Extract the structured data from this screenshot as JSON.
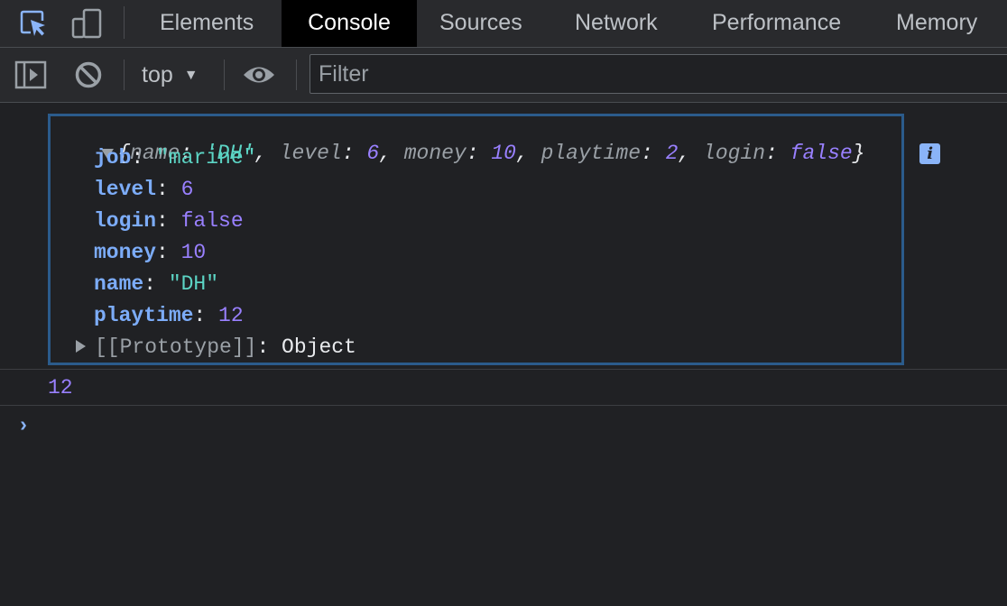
{
  "tabbar": {
    "tabs": [
      {
        "label": "Elements"
      },
      {
        "label": "Console"
      },
      {
        "label": "Sources"
      },
      {
        "label": "Network"
      },
      {
        "label": "Performance"
      },
      {
        "label": "Memory"
      }
    ],
    "active_tab": "Console",
    "icons": [
      "inspect-element-icon",
      "device-toolbar-icon"
    ]
  },
  "toolbar": {
    "context": "top",
    "filter_placeholder": "Filter",
    "icons": [
      "sidebar-toggle-icon",
      "clear-console-icon",
      "context-dropdown-caret-icon",
      "live-expression-eye-icon"
    ]
  },
  "console": {
    "object_summary": {
      "open": "{",
      "close": "}",
      "entries": [
        {
          "key": "name",
          "value": "'DH'",
          "kind": "string"
        },
        {
          "key": "level",
          "value": "6",
          "kind": "number"
        },
        {
          "key": "money",
          "value": "10",
          "kind": "number"
        },
        {
          "key": "playtime",
          "value": "2",
          "kind": "number"
        },
        {
          "key": "login",
          "value": "false",
          "kind": "boolean"
        }
      ],
      "info_badge": "i"
    },
    "properties": [
      {
        "key": "job",
        "value": "\"marine\"",
        "kind": "string"
      },
      {
        "key": "level",
        "value": "6",
        "kind": "number"
      },
      {
        "key": "login",
        "value": "false",
        "kind": "boolean"
      },
      {
        "key": "money",
        "value": "10",
        "kind": "number"
      },
      {
        "key": "name",
        "value": "\"DH\"",
        "kind": "string"
      },
      {
        "key": "playtime",
        "value": "12",
        "kind": "number"
      }
    ],
    "prototype": {
      "key": "[[Prototype]]",
      "value": "Object"
    },
    "result": "12",
    "prompt": "›"
  },
  "colors": {
    "background": "#202124",
    "toolbar": "#292a2d",
    "key": "#7cacf8",
    "string": "#5cd5c5",
    "number": "#9980ff",
    "highlight_border": "#2b5b8b"
  }
}
